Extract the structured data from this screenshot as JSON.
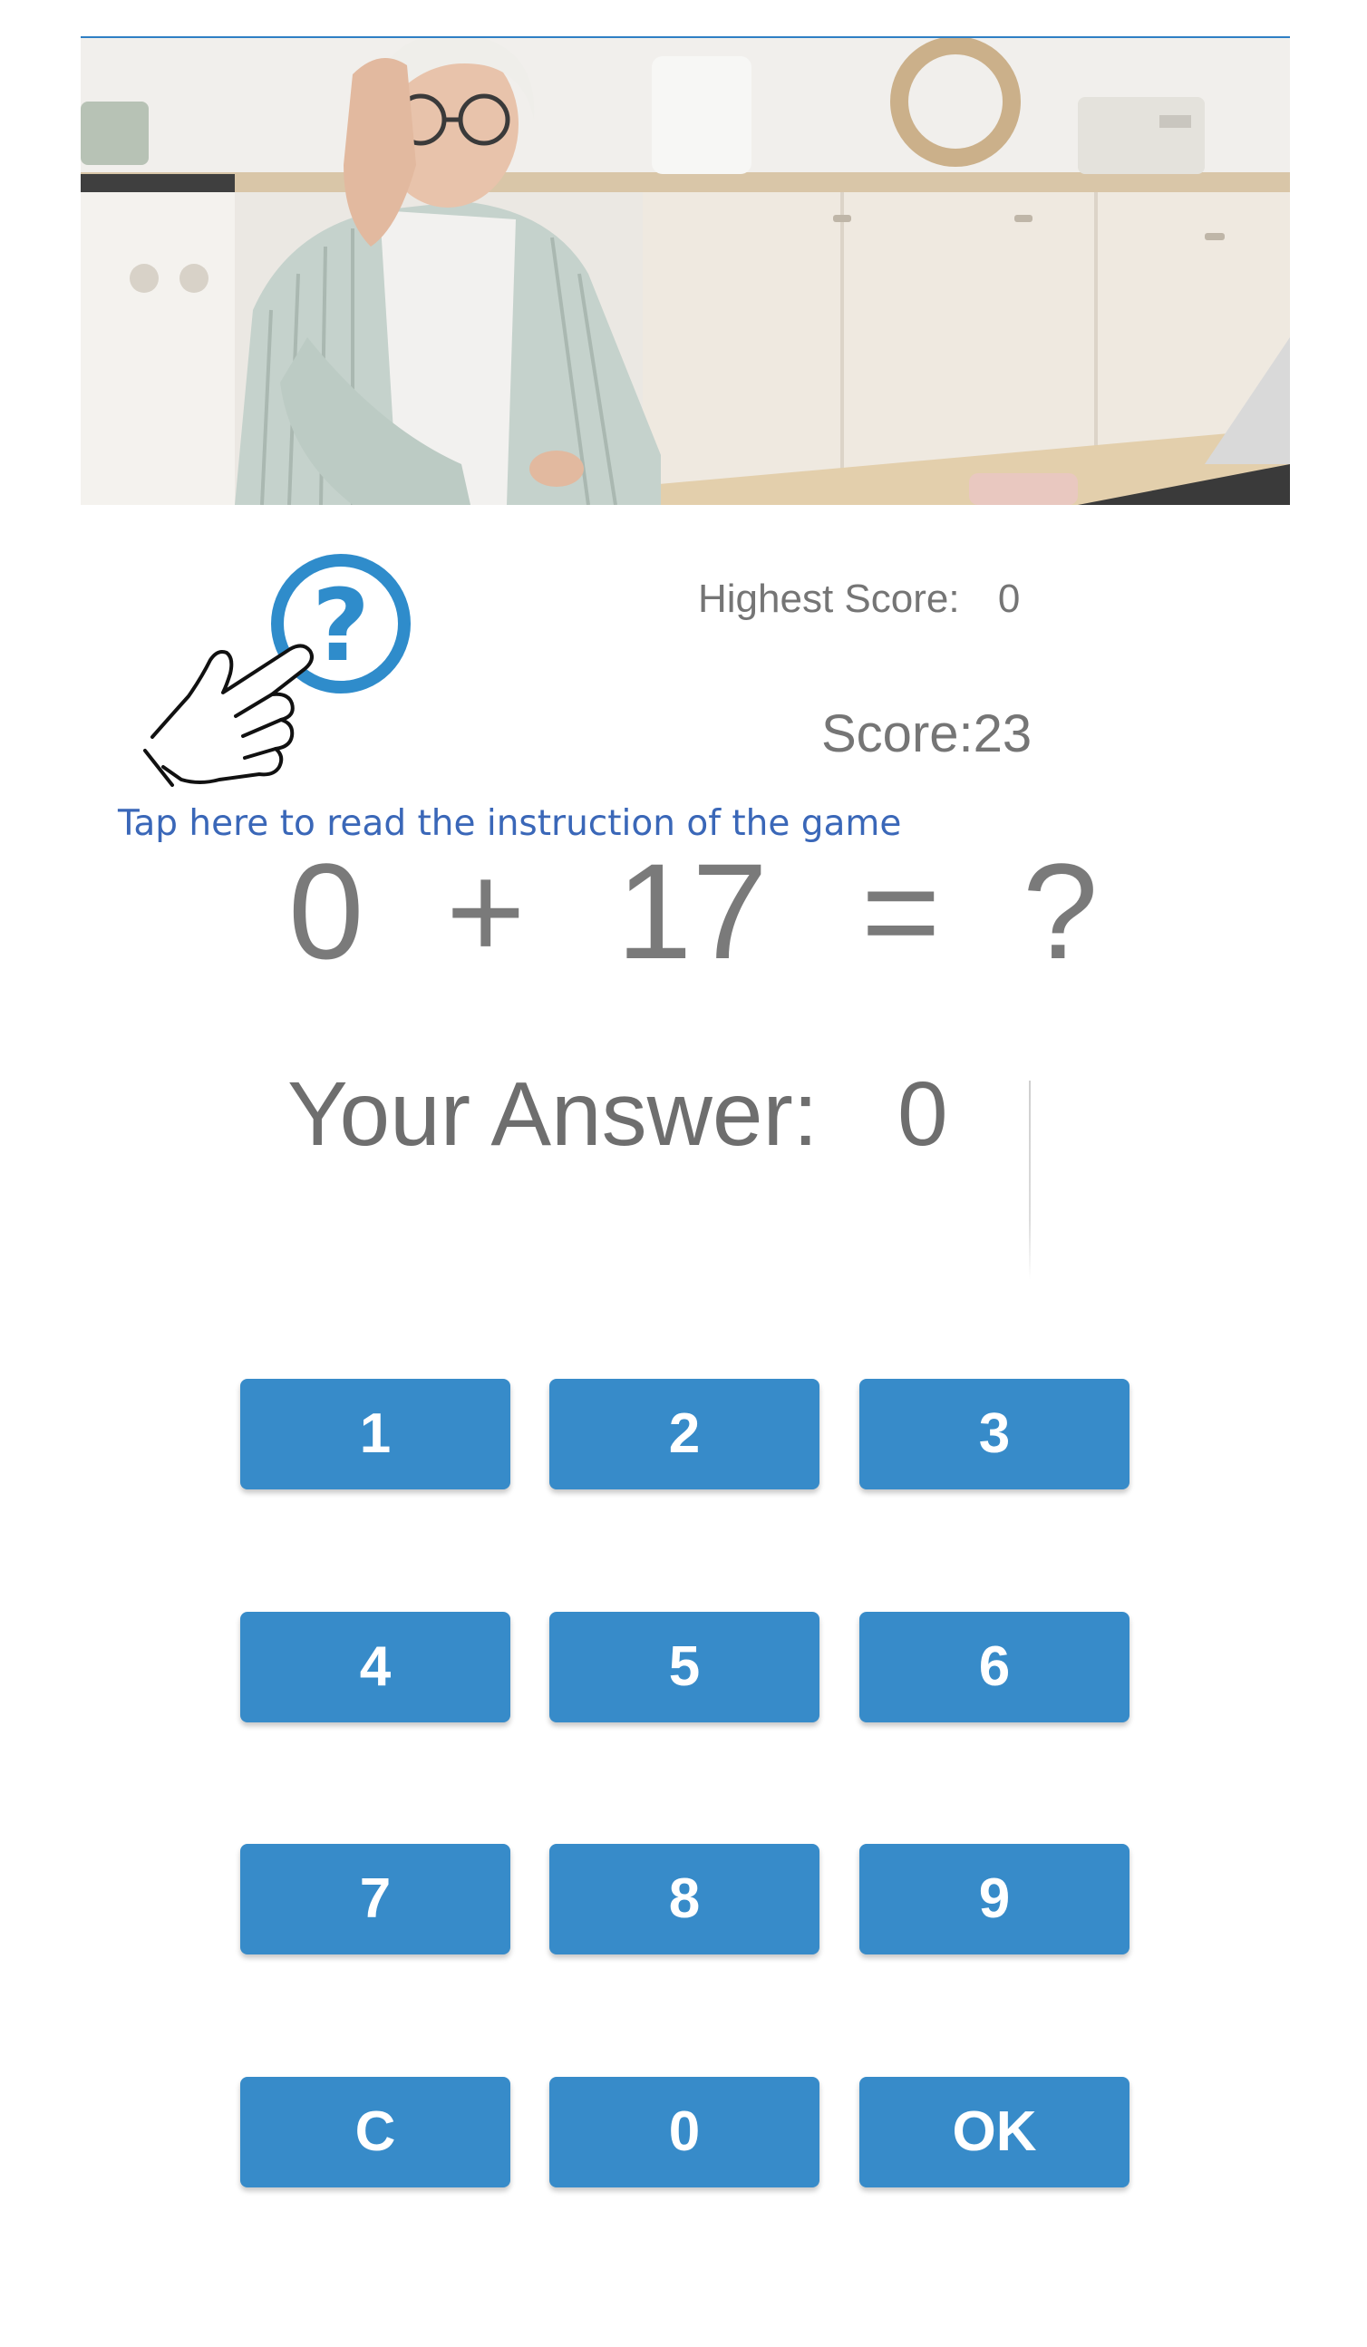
{
  "header": {
    "photo_alt": "photo-elderly-woman-kitchen"
  },
  "help": {
    "icon_glyph": "?",
    "instruction_text": "Tap here to read the instruction of the game"
  },
  "scores": {
    "highest_label": "Highest Score:",
    "highest_value": "0",
    "score_text": "Score:23"
  },
  "question": {
    "operand_a": "0",
    "operator": "+",
    "operand_b": "17",
    "equals": "=",
    "unknown": "?"
  },
  "answer": {
    "label": "Your Answer:",
    "value": "0"
  },
  "keypad": {
    "k1": "1",
    "k2": "2",
    "k3": "3",
    "k4": "4",
    "k5": "5",
    "k6": "6",
    "k7": "7",
    "k8": "8",
    "k9": "9",
    "clear": "C",
    "k0": "0",
    "ok": "OK"
  },
  "colors": {
    "accent": "#378bc9",
    "help_icon": "#2f8ccb",
    "instruction_text": "#3a67b8",
    "text_gray": "#757575"
  }
}
